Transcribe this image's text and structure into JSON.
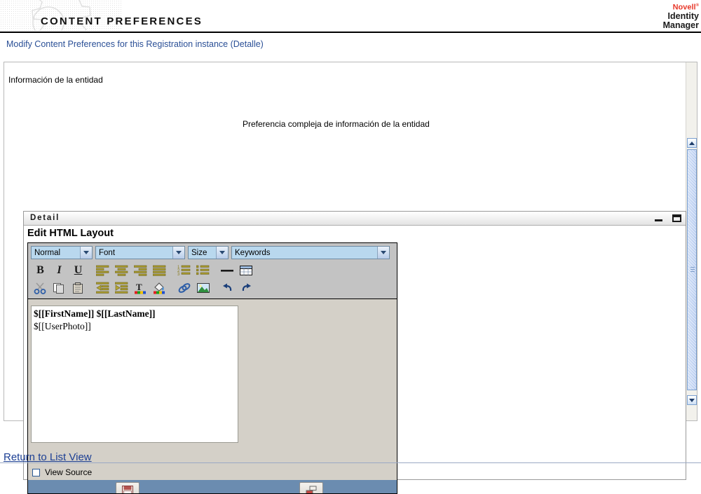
{
  "header": {
    "title": "CONTENT PREFERENCES",
    "gear_icon": "gear-icon",
    "brand": {
      "company": "Novell",
      "registered": "®",
      "product_line1": "Identity",
      "product_line2": "Manager"
    }
  },
  "breadcrumb": {
    "text": "Modify Content Preferences for this Registration instance (Detalle)"
  },
  "main": {
    "entity_label": "Información de la entidad",
    "complex_label": "Preferencia compleja de información de la entidad"
  },
  "detail_window": {
    "title": "Detail",
    "minimize_label": "Minimize",
    "maximize_label": "Maximize",
    "heading": "Edit HTML Layout"
  },
  "editor": {
    "dropdowns": [
      {
        "name": "paragraph-style",
        "value": "Normal"
      },
      {
        "name": "font-family",
        "value": "Font"
      },
      {
        "name": "font-size",
        "value": "Size"
      },
      {
        "name": "keywords",
        "value": "Keywords"
      }
    ],
    "toolbar_row1": [
      {
        "name": "bold-icon",
        "label": "B"
      },
      {
        "name": "italic-icon",
        "label": "I"
      },
      {
        "name": "underline-icon",
        "label": "U"
      },
      {
        "name": "align-left-icon",
        "label": ""
      },
      {
        "name": "align-center-icon",
        "label": ""
      },
      {
        "name": "align-right-icon",
        "label": ""
      },
      {
        "name": "align-justify-icon",
        "label": ""
      },
      {
        "name": "numbered-list-icon",
        "label": ""
      },
      {
        "name": "bullet-list-icon",
        "label": ""
      },
      {
        "name": "horizontal-rule-icon",
        "label": ""
      },
      {
        "name": "insert-table-icon",
        "label": ""
      }
    ],
    "toolbar_row2": [
      {
        "name": "cut-icon",
        "label": ""
      },
      {
        "name": "copy-icon",
        "label": ""
      },
      {
        "name": "paste-icon",
        "label": ""
      },
      {
        "name": "outdent-icon",
        "label": ""
      },
      {
        "name": "indent-icon",
        "label": ""
      },
      {
        "name": "text-color-icon",
        "label": "T"
      },
      {
        "name": "background-color-icon",
        "label": ""
      },
      {
        "name": "insert-link-icon",
        "label": ""
      },
      {
        "name": "insert-image-icon",
        "label": ""
      },
      {
        "name": "undo-icon",
        "label": ""
      },
      {
        "name": "redo-icon",
        "label": ""
      }
    ],
    "content": {
      "line1": "$[[FirstName]] $[[LastName]]",
      "line2": "$[[UserPhoto]]"
    },
    "view_source": {
      "label": "View Source",
      "checked": false
    },
    "action_buttons": [
      {
        "name": "save-button",
        "icon": "save-icon"
      },
      {
        "name": "layout-button",
        "icon": "layout-icon"
      }
    ]
  },
  "footer": {
    "return_link": "Return to List View"
  },
  "colors": {
    "brand_red": "#e8392b",
    "link_blue": "#1c3f94",
    "breadcrumb_blue": "#2a4f96",
    "dropdown_blue": "#b9d8ee",
    "toolbar_gray": "#c3c3c3",
    "canvas_gray": "#d4d0c8",
    "action_bar_blue": "#6b8cb0"
  }
}
